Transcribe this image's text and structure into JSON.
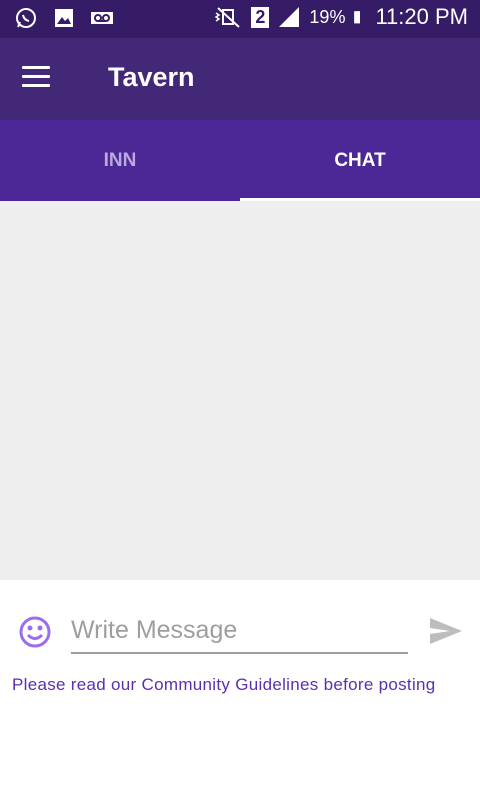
{
  "status_bar": {
    "battery": "19%",
    "time": "11:20 PM",
    "sim_badge": "2",
    "icons": [
      "whatsapp-icon",
      "image-icon",
      "voicemail-icon",
      "vibrate-off-icon",
      "signal-icon",
      "battery-icon"
    ]
  },
  "app_bar": {
    "title": "Tavern",
    "menu_icon": "hamburger-menu-icon"
  },
  "tabs": [
    {
      "label": "INN",
      "active": false
    },
    {
      "label": "CHAT",
      "active": true
    }
  ],
  "composer": {
    "placeholder": "Write Message",
    "value": "",
    "emoji_icon": "smiley-icon",
    "send_icon": "send-icon",
    "guidelines_text": "Please read our Community Guidelines before posting"
  },
  "colors": {
    "status_bar": "#361c66",
    "app_bar": "#432878",
    "tab_bar": "#4c2796",
    "accent": "#5b2fb0",
    "emoji": "#9c6cf0",
    "chat_background": "#eeeeee"
  }
}
